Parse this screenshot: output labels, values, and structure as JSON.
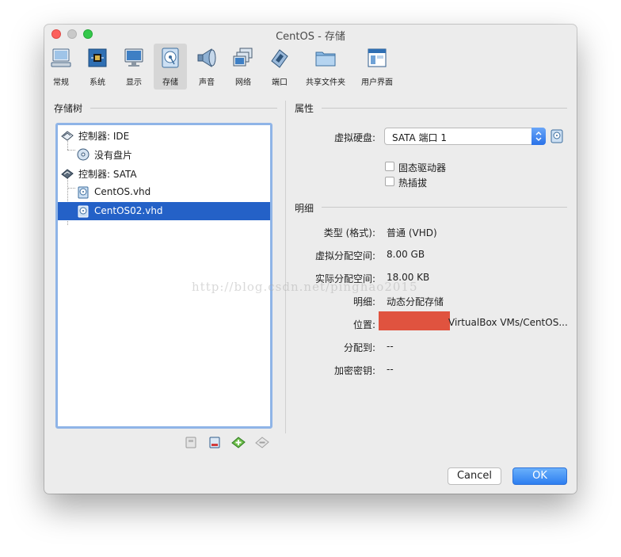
{
  "window": {
    "title": "CentOS - 存储"
  },
  "toolbar": {
    "items": [
      {
        "label": "常规",
        "icon": "general-icon"
      },
      {
        "label": "系统",
        "icon": "system-chip-icon"
      },
      {
        "label": "显示",
        "icon": "display-monitor-icon"
      },
      {
        "label": "存储",
        "icon": "storage-disk-icon",
        "selected": true
      },
      {
        "label": "声音",
        "icon": "speaker-icon"
      },
      {
        "label": "网络",
        "icon": "network-icon"
      },
      {
        "label": "端口",
        "icon": "port-connector-icon"
      },
      {
        "label": "共享文件夹",
        "icon": "shared-folder-icon"
      },
      {
        "label": "用户界面",
        "icon": "user-interface-icon"
      }
    ]
  },
  "storage_tree": {
    "title": "存储树",
    "rows": [
      {
        "label": "控制器: IDE",
        "icon": "ide-controller-icon"
      },
      {
        "label": "没有盘片",
        "icon": "optical-disc-icon"
      },
      {
        "label": "控制器: SATA",
        "icon": "sata-controller-icon"
      },
      {
        "label": "CentOS.vhd",
        "icon": "hard-disk-icon"
      },
      {
        "label": "CentOS02.vhd",
        "icon": "hard-disk-icon",
        "selected": true
      }
    ],
    "buttons": [
      "add-controller-icon",
      "remove-controller-icon",
      "add-attachment-icon",
      "remove-attachment-icon"
    ]
  },
  "attributes": {
    "title": "属性",
    "virtual_disk_label": "虚拟硬盘:",
    "virtual_disk_value": "SATA 端口 1",
    "ssd_label": "固态驱动器",
    "hotplug_label": "热插拔",
    "ssd_checked": false,
    "hotplug_checked": false
  },
  "details": {
    "title": "明细",
    "type_label": "类型 (格式):",
    "type_value": "普通 (VHD)",
    "virtual_size_label": "虚拟分配空间:",
    "virtual_size_value": "8.00 GB",
    "actual_size_label": "实际分配空间:",
    "actual_size_value": "18.00 KB",
    "detail_label": "明细:",
    "detail_value": "动态分配存储",
    "location_label": "位置:",
    "location_value": "VirtualBox VMs/CentOS...",
    "attached_label": "分配到:",
    "attached_value": "--",
    "encryption_label": "加密密钥:",
    "encryption_value": "--"
  },
  "watermark": "http://blog.csdn.net/pinghao2015",
  "buttons": {
    "cancel": "Cancel",
    "ok": "OK"
  },
  "colors": {
    "selection": "#2461c7",
    "accent": "#2d7ef0",
    "redaction": "#e0533f"
  }
}
